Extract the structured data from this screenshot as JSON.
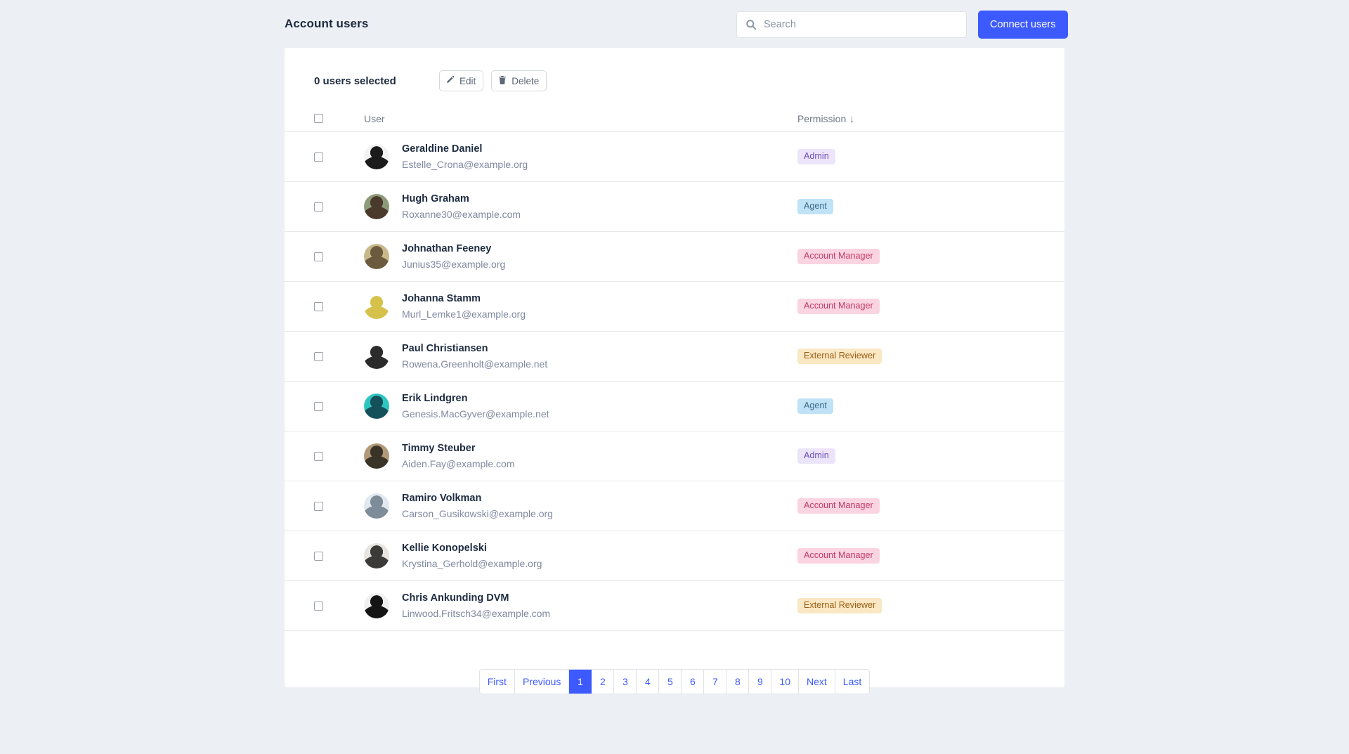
{
  "header": {
    "title": "Account users",
    "search": {
      "value": "",
      "placeholder": "Search"
    },
    "connect_button": "Connect users"
  },
  "toolbar": {
    "selected_label": "0 users selected",
    "edit_label": "Edit",
    "delete_label": "Delete"
  },
  "table": {
    "columns": {
      "user": "User",
      "permission": "Permission",
      "sort_arrow": "↓"
    },
    "rows": [
      {
        "name": "Geraldine Daniel",
        "email": "Estelle_Crona@example.org",
        "permission": "Admin",
        "avatar_colors": [
          "#f2f2f2",
          "#1b1b1b"
        ]
      },
      {
        "name": "Hugh Graham",
        "email": "Roxanne30@example.com",
        "permission": "Agent",
        "avatar_colors": [
          "#8d9b7a",
          "#4a3a2c"
        ]
      },
      {
        "name": "Johnathan Feeney",
        "email": "Junius35@example.org",
        "permission": "Account Manager",
        "avatar_colors": [
          "#c9b98a",
          "#6b5a3e"
        ]
      },
      {
        "name": "Johanna Stamm",
        "email": "Murl_Lemke1@example.org",
        "permission": "Account Manager",
        "avatar_colors": [
          "#ffffff",
          "#d6c24a"
        ]
      },
      {
        "name": "Paul Christiansen",
        "email": "Rowena.Greenholt@example.net",
        "permission": "External Reviewer",
        "avatar_colors": [
          "#ffffff",
          "#2b2b2b"
        ]
      },
      {
        "name": "Erik Lindgren",
        "email": "Genesis.MacGyver@example.net",
        "permission": "Agent",
        "avatar_colors": [
          "#2ec5c0",
          "#14505a"
        ]
      },
      {
        "name": "Timmy Steuber",
        "email": "Aiden.Fay@example.com",
        "permission": "Admin",
        "avatar_colors": [
          "#b09a78",
          "#3a3328"
        ]
      },
      {
        "name": "Ramiro Volkman",
        "email": "Carson_Gusikowski@example.org",
        "permission": "Account Manager",
        "avatar_colors": [
          "#e2e8ef",
          "#7e8c99"
        ]
      },
      {
        "name": "Kellie Konopelski",
        "email": "Krystina_Gerhold@example.org",
        "permission": "Account Manager",
        "avatar_colors": [
          "#e8e4df",
          "#3c3a38"
        ]
      },
      {
        "name": "Chris Ankunding DVM",
        "email": "Linwood.Fritsch34@example.com",
        "permission": "External Reviewer",
        "avatar_colors": [
          "#f0f0f0",
          "#151515"
        ]
      }
    ]
  },
  "pagination": {
    "items": [
      "First",
      "Previous",
      "1",
      "2",
      "3",
      "4",
      "5",
      "6",
      "7",
      "8",
      "9",
      "10",
      "Next",
      "Last"
    ],
    "active": "1"
  },
  "colors": {
    "accent": "#3d5afe",
    "page_background": "#ecf0f4",
    "card_background": "#ffffff",
    "badge_admin_bg": "#ece5fa",
    "badge_admin_fg": "#6a4fb8",
    "badge_agent_bg": "#bfe2f6",
    "badge_agent_fg": "#3f6b88",
    "badge_account_manager_bg": "#fad4e0",
    "badge_account_manager_fg": "#c23a6b",
    "badge_external_reviewer_bg": "#fae7c3",
    "badge_external_reviewer_fg": "#9a5f16"
  }
}
